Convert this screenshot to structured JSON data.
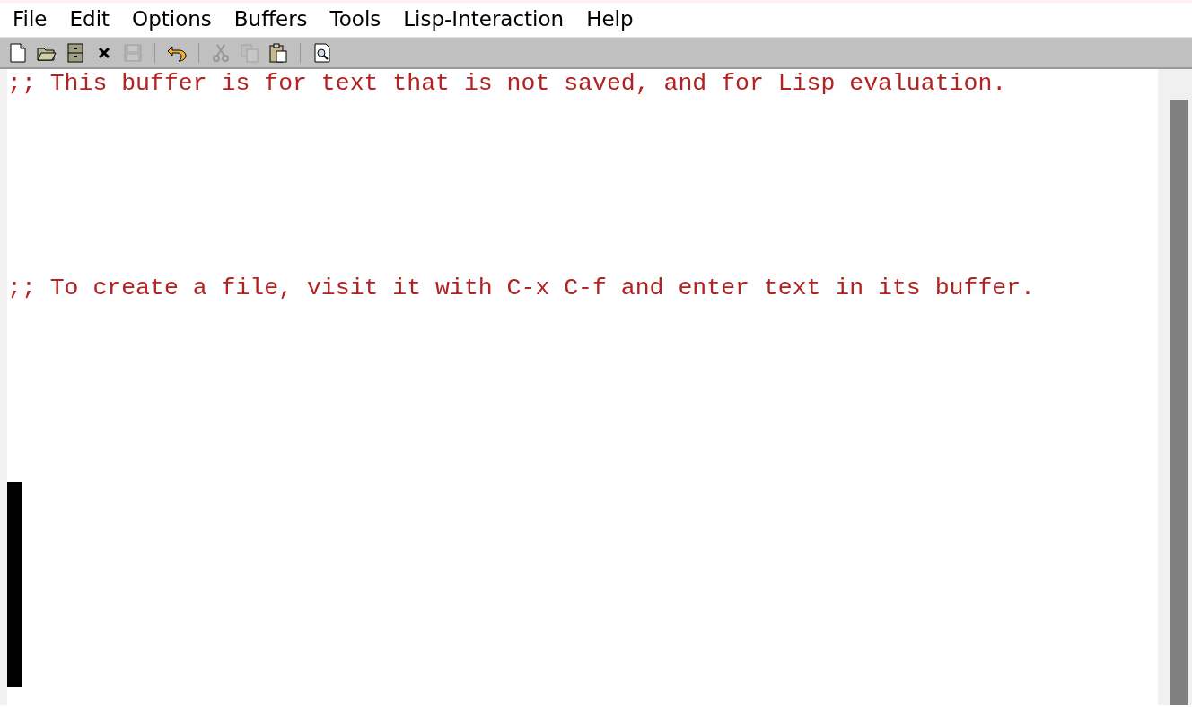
{
  "menu_bar": [
    {
      "label": "File"
    },
    {
      "label": "Edit"
    },
    {
      "label": "Options"
    },
    {
      "label": "Buffers"
    },
    {
      "label": "Tools"
    },
    {
      "label": "Lisp-Interaction"
    },
    {
      "label": "Help"
    }
  ],
  "toolbar": [
    {
      "kind": "new",
      "disabled": false
    },
    {
      "kind": "open",
      "disabled": false
    },
    {
      "kind": "cabinet",
      "disabled": false
    },
    {
      "kind": "close",
      "disabled": false
    },
    {
      "kind": "save",
      "disabled": true
    },
    {
      "kind": "separator"
    },
    {
      "kind": "undo",
      "disabled": false
    },
    {
      "kind": "separator"
    },
    {
      "kind": "cut",
      "disabled": true
    },
    {
      "kind": "copy",
      "disabled": true
    },
    {
      "kind": "paste",
      "disabled": false
    },
    {
      "kind": "separator"
    },
    {
      "kind": "search",
      "disabled": false
    }
  ],
  "buffer": {
    "lines": [
      {
        "text": ";; This buffer is for text that is not saved, and for Lisp evaluation."
      },
      {
        "text": ";; To create a file, visit it with C-x C-f and enter text in its buffer."
      }
    ]
  }
}
